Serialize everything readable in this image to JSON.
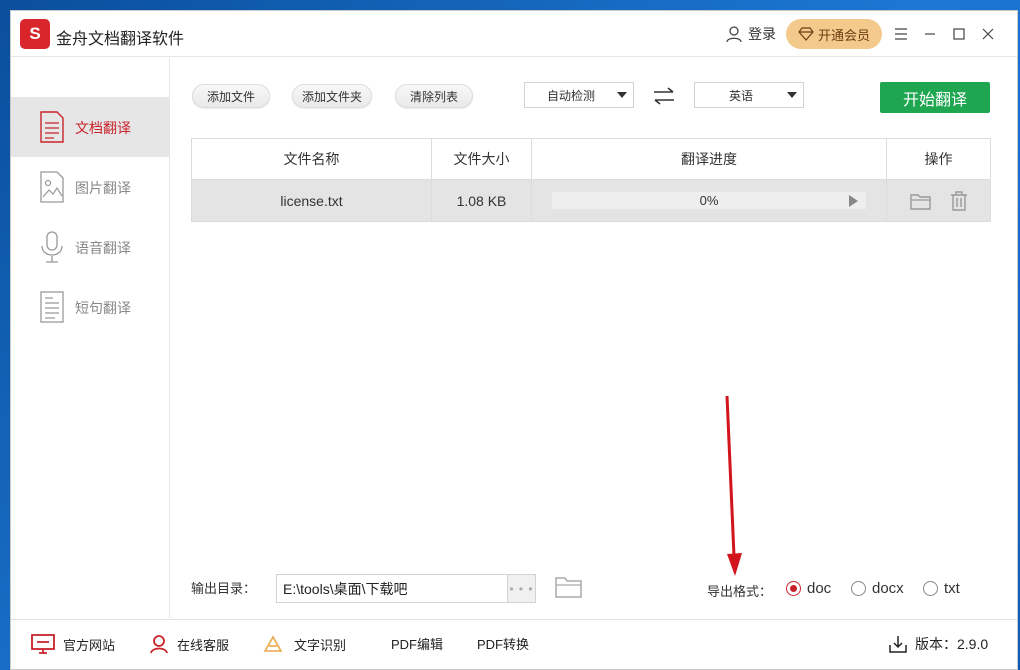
{
  "app": {
    "logo_char": "S",
    "title": "金舟文档翻译软件"
  },
  "header": {
    "login_label": "登录",
    "vip_label": "开通会员"
  },
  "sidebar": {
    "items": [
      {
        "label": "文档翻译",
        "icon": "document-icon",
        "active": true
      },
      {
        "label": "图片翻译",
        "icon": "image-icon",
        "active": false
      },
      {
        "label": "语音翻译",
        "icon": "microphone-icon",
        "active": false
      },
      {
        "label": "短句翻译",
        "icon": "text-page-icon",
        "active": false
      }
    ]
  },
  "toolbar": {
    "add_file": "添加文件",
    "add_folder": "添加文件夹",
    "clear_list": "清除列表",
    "source_lang": "自动检测",
    "target_lang": "英语",
    "start_label": "开始翻译"
  },
  "table": {
    "headers": [
      "文件名称",
      "文件大小",
      "翻译进度",
      "操作"
    ],
    "rows": [
      {
        "name": "license.txt",
        "size": "1.08 KB",
        "progress": "0%"
      }
    ]
  },
  "output": {
    "dir_label": "输出目录：",
    "dir_value": "E:\\tools\\桌面\\下载吧",
    "dots": "• • •",
    "format_label": "导出格式：",
    "formats": [
      "doc",
      "docx",
      "txt"
    ],
    "selected_format": "doc"
  },
  "footer": {
    "official_site": "官方网站",
    "online_service": "在线客服",
    "ocr": "文字识别",
    "pdf_edit": "PDF编辑",
    "pdf_convert": "PDF转换",
    "version": "版本：2.9.0"
  },
  "colors": {
    "accent": "#c8232b",
    "start_button": "#1fa650",
    "vip": "#f3c98c"
  }
}
